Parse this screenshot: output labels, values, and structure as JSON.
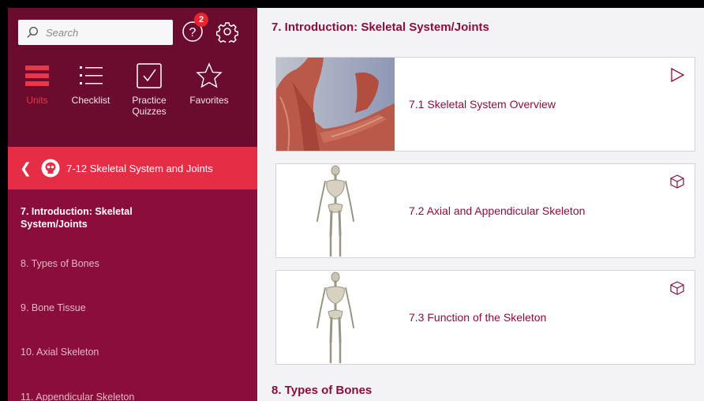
{
  "sidebar": {
    "search_placeholder": "Search",
    "help_badge": "2",
    "nav": [
      {
        "label": "Units",
        "icon": "hamburger-icon",
        "active": true
      },
      {
        "label": "Checklist",
        "icon": "checklist-icon"
      },
      {
        "label": "Practice Quizzes",
        "icon": "checkbox-icon"
      },
      {
        "label": "Favorites",
        "icon": "star-icon"
      }
    ],
    "unit_header": "7-12 Skeletal System and Joints",
    "sections": [
      "7. Introduction: Skeletal System/Joints",
      "8. Types of Bones",
      "9. Bone Tissue",
      "10. Axial Skeleton",
      "11. Appendicular Skeleton"
    ]
  },
  "main": {
    "section_title": "7. Introduction: Skeletal System/Joints",
    "cards": [
      {
        "title": "7.1 Skeletal System Overview",
        "icon": "play-icon"
      },
      {
        "title": "7.2 Axial and Appendicular Skeleton",
        "icon": "cube-icon"
      },
      {
        "title": "7.3 Function of the Skeleton",
        "icon": "cube-icon"
      }
    ],
    "next_section_title": "8. Types of Bones"
  },
  "colors": {
    "sidebar": "#8a0e3b",
    "sidebar_top": "#6b0b2d",
    "accent": "#e52e45",
    "title": "#8a0e3b"
  }
}
